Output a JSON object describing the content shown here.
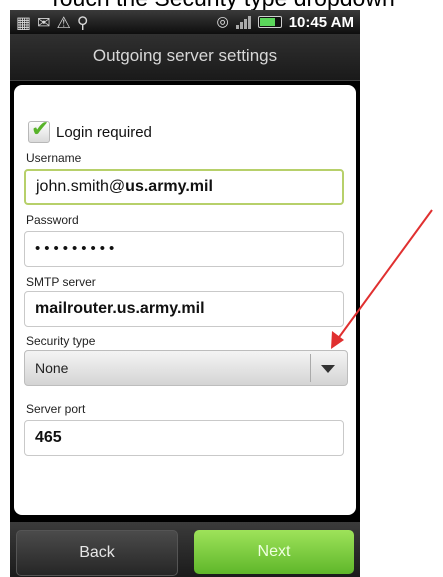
{
  "caption": "Touch the Security type dropdown",
  "status_bar": {
    "icons": [
      "gallery-icon",
      "mail-icon",
      "triangle-alert-icon",
      "usb-icon"
    ],
    "time": "10:45 AM"
  },
  "header": {
    "title": "Outgoing server settings"
  },
  "form": {
    "login_required": {
      "label": "Login required",
      "checked": true
    },
    "username": {
      "label": "Username",
      "value_user": "john.smith@",
      "value_domain": "us.army.mil"
    },
    "password": {
      "label": "Password",
      "value": "•••••••••"
    },
    "smtp_server": {
      "label": "SMTP server",
      "value": "mailrouter.us.army.mil"
    },
    "security_type": {
      "label": "Security type",
      "value": "None"
    },
    "server_port": {
      "label": "Server port",
      "value": "465"
    }
  },
  "buttons": {
    "back": "Back",
    "next": "Next"
  },
  "colors": {
    "accent_green": "#6cc130",
    "arrow": "#e03030"
  }
}
